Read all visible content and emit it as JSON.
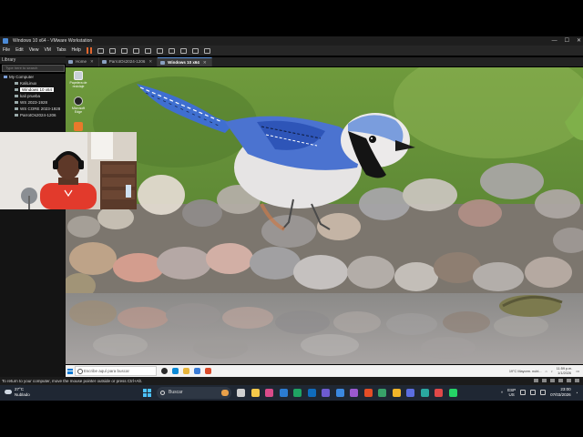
{
  "vmware": {
    "window_title": "Windows 10 x64 - VMware Workstation",
    "window_controls": [
      "—",
      "☐",
      "✕"
    ],
    "menu": [
      "File",
      "Edit",
      "View",
      "VM",
      "Tabs",
      "Help"
    ],
    "library_title": "Library",
    "library_search_placeholder": "Type here to search",
    "tree_root": "My Computer",
    "tree_items": [
      "KaliLinux",
      "Windows 10 x64",
      "kali prueba",
      "WS 2023-1928",
      "WS CORE 2023-1928",
      "ParrotOs2024-1206"
    ],
    "selected_item_index": 1,
    "tabs": [
      {
        "label": "Home",
        "active": false
      },
      {
        "label": "ParrotOs2024-1206",
        "active": false
      },
      {
        "label": "Windows 10 x64",
        "active": true
      }
    ],
    "status_hint": "To return to your computer, move the mouse pointer outside or press Ctrl+Alt."
  },
  "guest": {
    "desktop_icons": [
      "Papelera de reciclaje",
      "Microsoft Edge",
      "Avast"
    ],
    "search_placeholder": "Escribe aquí para buscar",
    "weather": "19°C  Mayorm. nubl...",
    "time": "11:59 p.m.",
    "date": "1/1/2026"
  },
  "host": {
    "weather_temp": "27°C",
    "weather_desc": "Nublado",
    "search_placeholder": "Buscar",
    "lang_top": "ESP",
    "lang_bottom": "US",
    "time": "23:00",
    "date": "07/03/2026"
  },
  "colors": {
    "host_taskbar": "#1f2733",
    "vmware_dark": "#262626",
    "accent": "#4cc2ff"
  }
}
